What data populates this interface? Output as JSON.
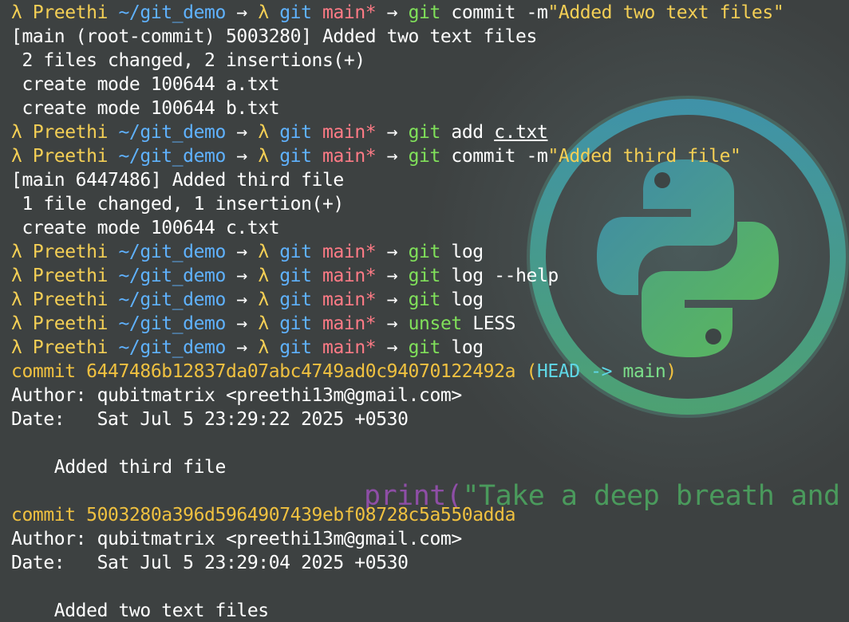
{
  "terminal": {
    "prompt": {
      "lambda": "λ",
      "user": "Preethi",
      "path": "~/git_demo",
      "arrow": "→",
      "vcs": "git",
      "branch": "main*"
    },
    "lines": [
      {
        "type": "prompt",
        "cmd": "git",
        "args": "commit -m",
        "quoted": "\"Added two text files\""
      },
      {
        "type": "output",
        "text": "[main (root-commit) 5003280] Added two text files"
      },
      {
        "type": "output",
        "text": " 2 files changed, 2 insertions(+)"
      },
      {
        "type": "output",
        "text": " create mode 100644 a.txt"
      },
      {
        "type": "output",
        "text": " create mode 100644 b.txt"
      },
      {
        "type": "prompt",
        "cmd": "git",
        "args": "add ",
        "underlined": "c.txt"
      },
      {
        "type": "prompt",
        "cmd": "git",
        "args": "commit -m",
        "quoted": "\"Added third file\""
      },
      {
        "type": "output",
        "text": "[main 6447486] Added third file"
      },
      {
        "type": "output",
        "text": " 1 file changed, 1 insertion(+)"
      },
      {
        "type": "output",
        "text": " create mode 100644 c.txt"
      },
      {
        "type": "prompt",
        "cmd": "git",
        "args": "log"
      },
      {
        "type": "prompt",
        "cmd": "git",
        "args": "log --help"
      },
      {
        "type": "prompt",
        "cmd": "git",
        "args": "log"
      },
      {
        "type": "prompt",
        "cmd": "unset",
        "args": "LESS"
      },
      {
        "type": "prompt",
        "cmd": "git",
        "args": "log"
      },
      {
        "type": "commit",
        "label": "commit",
        "hash": "6447486b12837da07abc4749ad0c94070122492a",
        "head_open": "(",
        "head": "HEAD -> ",
        "branch": "main",
        "head_close": ")"
      },
      {
        "type": "output",
        "text": "Author: qubitmatrix <preethi13m@gmail.com>"
      },
      {
        "type": "output",
        "text": "Date:   Sat Jul 5 23:29:22 2025 +0530"
      },
      {
        "type": "output",
        "text": ""
      },
      {
        "type": "output",
        "text": "    Added third file"
      },
      {
        "type": "output",
        "text": ""
      },
      {
        "type": "commit",
        "label": "commit",
        "hash": "5003280a396d5964907439ebf08728c5a550adda"
      },
      {
        "type": "output",
        "text": "Author: qubitmatrix <preethi13m@gmail.com>"
      },
      {
        "type": "output",
        "text": "Date:   Sat Jul 5 23:29:04 2025 +0530"
      },
      {
        "type": "output",
        "text": ""
      },
      {
        "type": "output",
        "text": "    Added two text files"
      }
    ]
  },
  "wallpaper": {
    "print_keyword": "print(",
    "print_text": "\"Take a deep breath and s",
    "logo": "python-logo-icon",
    "colors": {
      "background": "#3f4444",
      "ring": "#48a8b8",
      "logo_top": "#4aa0b0",
      "logo_bottom": "#5cb860"
    }
  },
  "colors": {
    "prompt_yellow": "#f4cf55",
    "path_blue": "#5fb2ff",
    "branch_pink": "#ff7b86",
    "cmd_green": "#80e05a",
    "commit_yellow": "#f0c140",
    "head_cyan": "#5fd7e6"
  }
}
